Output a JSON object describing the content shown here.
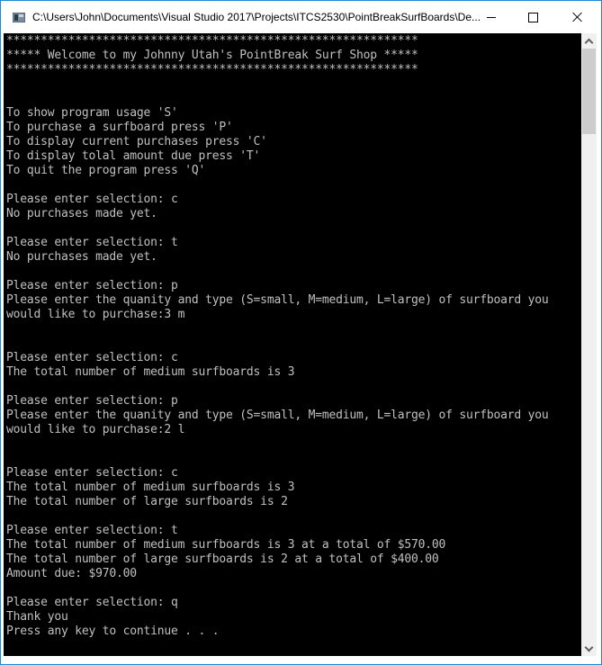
{
  "window": {
    "title": "C:\\Users\\John\\Documents\\Visual Studio 2017\\Projects\\ITCS2530\\PointBreakSurfBoards\\De...",
    "icon": "console-app-icon",
    "controls": {
      "minimize": "minimize-icon",
      "maximize": "maximize-icon",
      "close": "close-icon"
    }
  },
  "console": {
    "lines": [
      "************************************************************",
      "***** Welcome to my Johnny Utah's PointBreak Surf Shop *****",
      "************************************************************",
      "",
      "",
      "To show program usage 'S'",
      "To purchase a surfboard press 'P'",
      "To display current purchases press 'C'",
      "To display tolal amount due press 'T'",
      "To quit the program press 'Q'",
      "",
      "Please enter selection: c",
      "No purchases made yet.",
      "",
      "Please enter selection: t",
      "No purchases made yet.",
      "",
      "Please enter selection: p",
      "Please enter the quanity and type (S=small, M=medium, L=large) of surfboard you",
      "would like to purchase:3 m",
      "",
      "",
      "Please enter selection: c",
      "The total number of medium surfboards is 3",
      "",
      "Please enter selection: p",
      "Please enter the quanity and type (S=small, M=medium, L=large) of surfboard you",
      "would like to purchase:2 l",
      "",
      "",
      "Please enter selection: c",
      "The total number of medium surfboards is 3",
      "The total number of large surfboards is 2",
      "",
      "Please enter selection: t",
      "The total number of medium surfboards is 3 at a total of $570.00",
      "The total number of large surfboards is 2 at a total of $400.00",
      "Amount due: $970.00",
      "",
      "Please enter selection: q",
      "Thank you",
      "Press any key to continue . . ."
    ]
  },
  "scrollbar": {
    "up_icon": "chevron-up-icon",
    "down_icon": "chevron-down-icon"
  },
  "colors": {
    "console_bg": "#000000",
    "console_fg": "#c0c0c0",
    "window_border": "#1a8ad4",
    "scrollbar_track": "#f0f0f0",
    "scrollbar_thumb": "#cdcdcd"
  }
}
